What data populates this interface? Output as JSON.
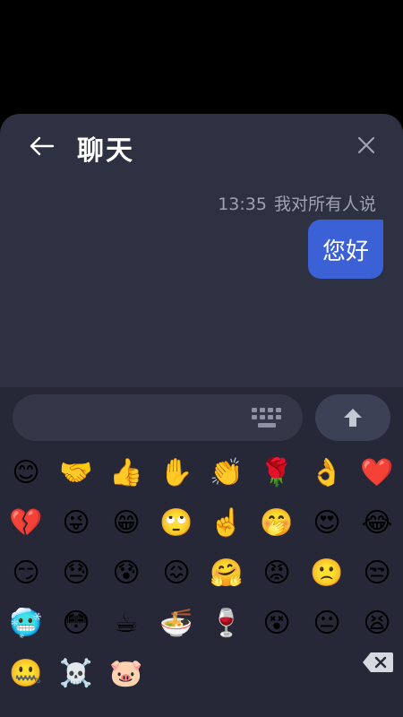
{
  "header": {
    "title": "聊天",
    "back_icon": "arrow-left-icon",
    "close_icon": "close-icon"
  },
  "message": {
    "time": "13:35",
    "scope": "我对所有人说",
    "text": "您好",
    "bubble_color": "#3c60d6"
  },
  "composer": {
    "input_value": "",
    "keyboard_icon": "keyboard-icon",
    "send_icon": "send-arrow-up-icon"
  },
  "emoji_panel": {
    "emojis": [
      "😊",
      "🤝",
      "👍",
      "✋",
      "👏",
      "🌹",
      "👌",
      "❤️",
      "💔",
      "😜",
      "😁",
      "🙄",
      "☝️",
      "🤭",
      "😍",
      "😂",
      "😏",
      "😓",
      "😰",
      "😖",
      "🤗",
      "😡",
      "🙁",
      "😒",
      "🥶",
      "😳",
      "☕",
      "🍜",
      "🍷",
      "😵",
      "😐",
      "😫",
      "🤐",
      "☠️",
      "🐷"
    ],
    "backspace_icon": "backspace-icon"
  },
  "colors": {
    "panel": "#2e3142",
    "input_area": "#262837",
    "muted_text": "#9ea2b4"
  }
}
